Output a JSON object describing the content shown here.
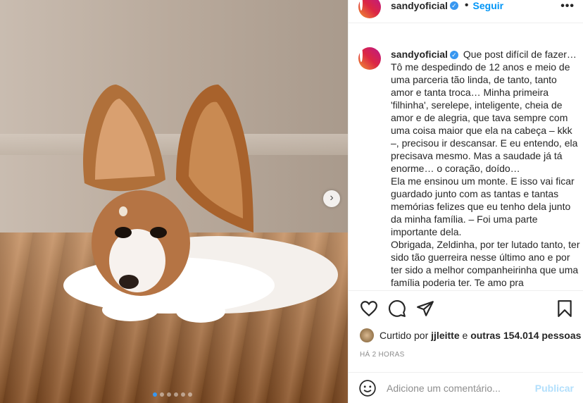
{
  "post": {
    "username": "sandyoficial",
    "follow_label": "Seguir",
    "more_label": "•••",
    "verified_label": "✓",
    "caption": "Que post difícil de fazer…\nTô me despedindo de 12 anos e meio de uma parceria tão linda, de tanto, tanto amor e tanta troca… Minha primeira 'filhinha', serelepe, inteligente, cheia de amor e de alegria, que tava sempre com uma coisa maior que ela na cabeça – kkk –, precisou ir descansar. E eu entendo, ela precisava mesmo. Mas a saudade já tá enorme… o coração, doído…\nEla me ensinou um monte. E isso vai ficar guardado junto com as tantas e tantas memórias felizes que eu tenho dela junto da minha família. – Foi uma parte importante dela.\nObrigada, Zeldinha, por ter lutado tanto, ter sido tão guerreira nesse último ano e por ter sido a melhor companheirinha que uma família poderia ter. Te amo pra",
    "likes_prefix": "Curtido por",
    "likes_user": "jjleitte",
    "likes_connector": "e",
    "likes_others": "outras 154.014 pessoas",
    "timestamp": "HÁ 2 HORAS",
    "comment_placeholder": "Adicione um comentário...",
    "publish_label": "Publicar",
    "next_label": "›",
    "carousel": {
      "count": 6,
      "active_index": 0
    }
  },
  "icons": {
    "like": "heart-icon",
    "comment": "comment-icon",
    "share": "send-icon",
    "save": "bookmark-icon",
    "emoji": "emoji-icon",
    "verified": "verified-badge-icon",
    "next": "chevron-right-icon"
  },
  "colors": {
    "accent": "#0095f6",
    "publish_disabled": "#b2dffc",
    "carousel_active": "#3897f0"
  }
}
